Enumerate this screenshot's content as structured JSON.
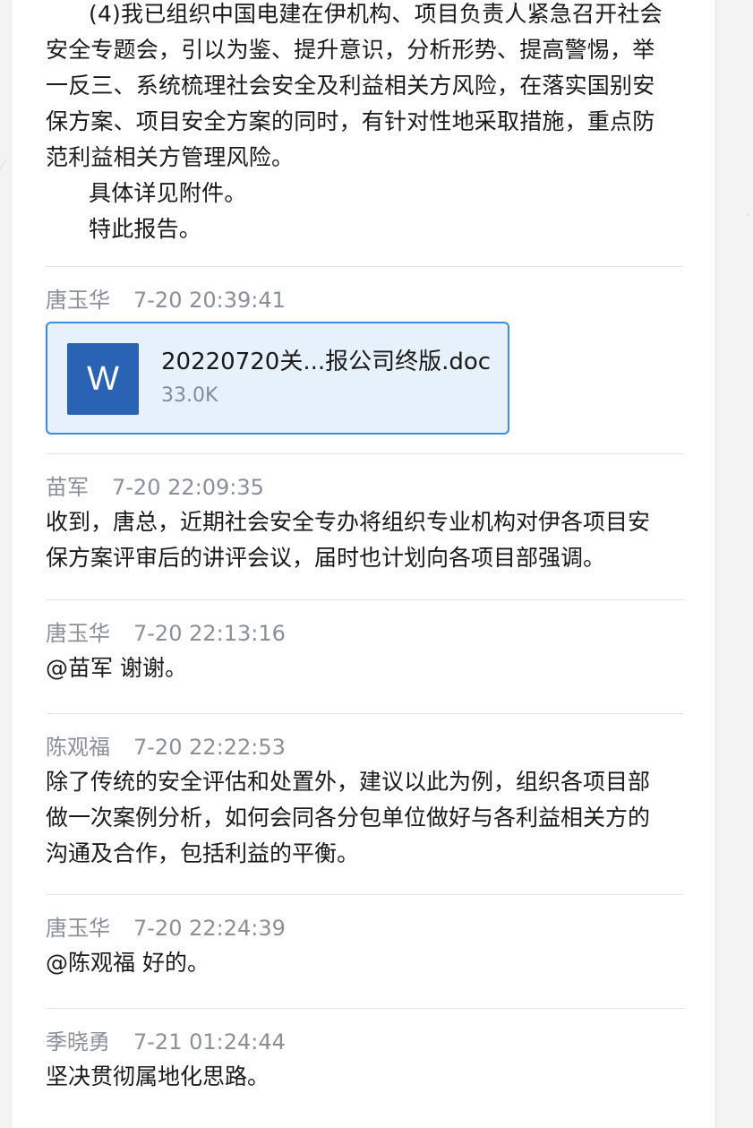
{
  "top_text": {
    "lines_para1": [
      "(4)我已组织中国电建在伊机构、项目负责人紧急召开社会",
      "安全专题会，引以为鉴、提升意识，分析形势、提高警惕，举",
      "一反三、系统梳理社会安全及利益相关方风险，在落实国别安",
      "保方案、项目安全方案的同时，有针对性地采取措施，重点防",
      "范利益相关方管理风险。"
    ],
    "para2": "具体详见附件。",
    "para3": "特此报告。"
  },
  "messages": [
    {
      "sender": "唐玉华",
      "time": "7-20 20:39:41",
      "file": {
        "icon": "word-doc-icon",
        "icon_letter": "W",
        "name": "20220720关...报公司终版.doc",
        "size": "33.0K"
      }
    },
    {
      "sender": "苗军",
      "time": "7-20 22:09:35",
      "lines": [
        "收到，唐总，近期社会安全专办将组织专业机构对伊各项目安",
        "保方案评审后的讲评会议，届时也计划向各项目部强调。"
      ]
    },
    {
      "sender": "唐玉华",
      "time": "7-20 22:13:16",
      "lines": [
        "@苗军 谢谢。"
      ]
    },
    {
      "sender": "陈观福",
      "time": "7-20 22:22:53",
      "lines": [
        "除了传统的安全评估和处置外，建议以此为例，组织各项目部",
        "做一次案例分析，如何会同各分包单位做好与各利益相关方的",
        "沟通及合作，包括利益的平衡。"
      ]
    },
    {
      "sender": "唐玉华",
      "time": "7-20 22:24:39",
      "lines": [
        "@陈观福 好的。"
      ]
    },
    {
      "sender": "季晓勇",
      "time": "7-21 01:24:44",
      "lines": [
        "坚决贯彻属地化思路。"
      ]
    }
  ],
  "colors": {
    "accent_border": "#3a8ee6",
    "file_card_bg": "#e6f1fc",
    "word_icon": "#2b63b4",
    "meta_text": "#8a8f99",
    "body_text": "#1a1a1a"
  }
}
